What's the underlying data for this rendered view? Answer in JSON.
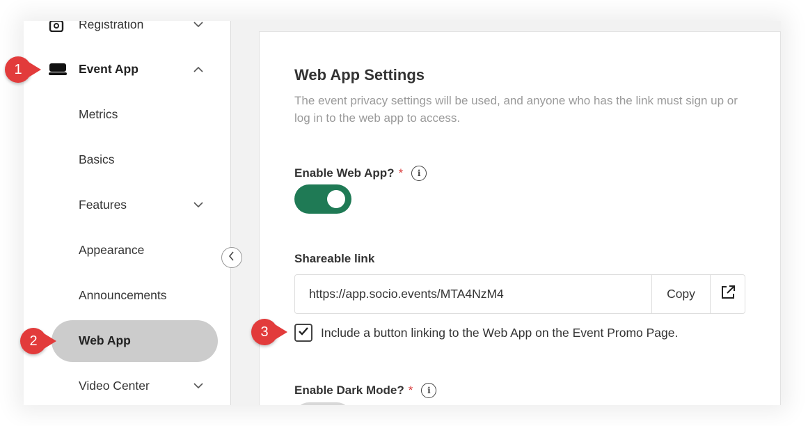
{
  "sidebar": {
    "items": [
      {
        "label": "Registration",
        "icon": "registration-icon",
        "expanded": false
      },
      {
        "label": "Event App",
        "icon": "laptop-icon",
        "expanded": true
      },
      {
        "label": "Metrics"
      },
      {
        "label": "Basics"
      },
      {
        "label": "Features",
        "expanded": false
      },
      {
        "label": "Appearance"
      },
      {
        "label": "Announcements"
      },
      {
        "label": "Web App",
        "active": true
      },
      {
        "label": "Video Center",
        "expanded": false
      }
    ],
    "collapse_icon": "chevron-left-icon"
  },
  "main": {
    "title": "Web App Settings",
    "description": "The event privacy settings will be used, and anyone who has the link must sign up or log in to the web app to access.",
    "enable_web_app": {
      "label": "Enable Web App?",
      "required_mark": "*",
      "info_icon": "i",
      "value": true
    },
    "shareable_link": {
      "label": "Shareable link",
      "value": "https://app.socio.events/MTA4NzM4",
      "copy_label": "Copy",
      "open_icon": "external-link-icon"
    },
    "include_button": {
      "checked": true,
      "label": "Include a button linking to the Web App on the Event Promo Page."
    },
    "enable_dark_mode": {
      "label": "Enable Dark Mode?",
      "required_mark": "*",
      "info_icon": "i",
      "value": false
    }
  },
  "callouts": [
    "1",
    "2",
    "3"
  ],
  "colors": {
    "toggle_on": "#1f7a55",
    "callout": "#e23b3b",
    "active_pill": "#cccccc",
    "required": "#d93b3b"
  }
}
